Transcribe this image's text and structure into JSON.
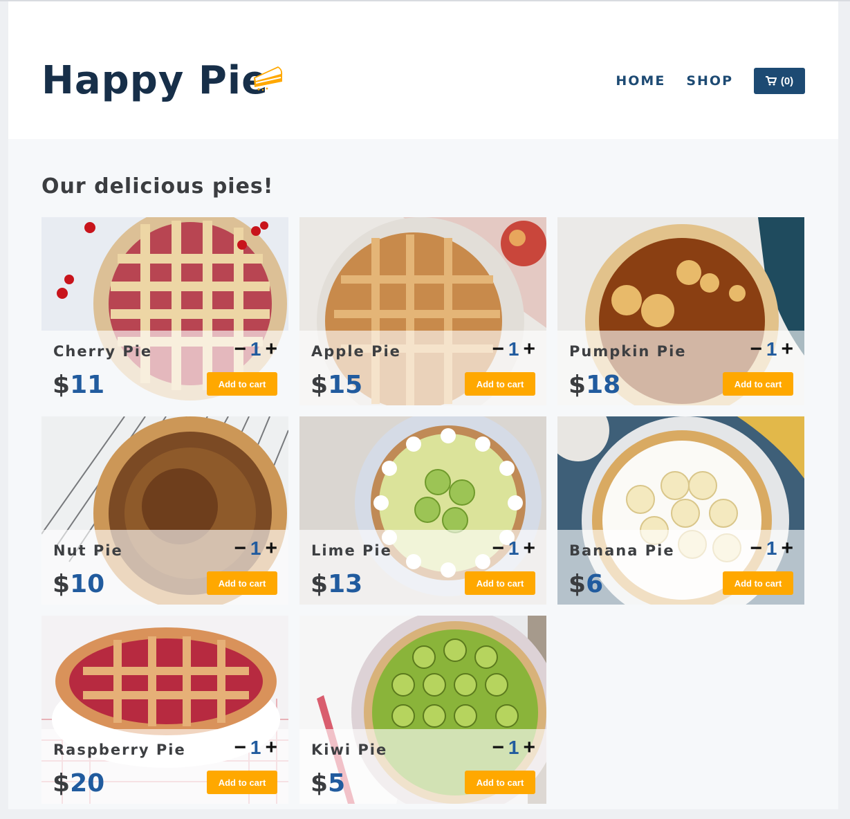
{
  "header": {
    "logo_text": "Happy Pie",
    "nav": {
      "home": "HOME",
      "shop": "SHOP"
    },
    "cart_label": "(0)"
  },
  "main": {
    "title": "Our delicious pies!",
    "products": [
      {
        "name": "Cherry Pie",
        "currency": "$",
        "price": "11",
        "qty": "1",
        "minus": "−",
        "plus": "+",
        "button": "Add to cart"
      },
      {
        "name": "Apple Pie",
        "currency": "$",
        "price": "15",
        "qty": "1",
        "minus": "−",
        "plus": "+",
        "button": "Add to cart"
      },
      {
        "name": "Pumpkin Pie",
        "currency": "$",
        "price": "18",
        "qty": "1",
        "minus": "−",
        "plus": "+",
        "button": "Add to cart"
      },
      {
        "name": "Nut Pie",
        "currency": "$",
        "price": "10",
        "qty": "1",
        "minus": "−",
        "plus": "+",
        "button": "Add to cart"
      },
      {
        "name": "Lime Pie",
        "currency": "$",
        "price": "13",
        "qty": "1",
        "minus": "−",
        "plus": "+",
        "button": "Add to cart"
      },
      {
        "name": "Banana Pie",
        "currency": "$",
        "price": "6",
        "qty": "1",
        "minus": "−",
        "plus": "+",
        "button": "Add to cart"
      },
      {
        "name": "Raspberry Pie",
        "currency": "$",
        "price": "20",
        "qty": "1",
        "minus": "−",
        "plus": "+",
        "button": "Add to cart"
      },
      {
        "name": "Kiwi Pie",
        "currency": "$",
        "price": "5",
        "qty": "1",
        "minus": "−",
        "plus": "+",
        "button": "Add to cart"
      }
    ]
  },
  "colors": {
    "brand_navy": "#172f49",
    "nav_blue": "#1d4a73",
    "accent_orange": "#ffa800",
    "price_blue": "#215b9e"
  },
  "icons": {
    "logo": "pie-slice-icon",
    "cart": "cart-icon"
  }
}
